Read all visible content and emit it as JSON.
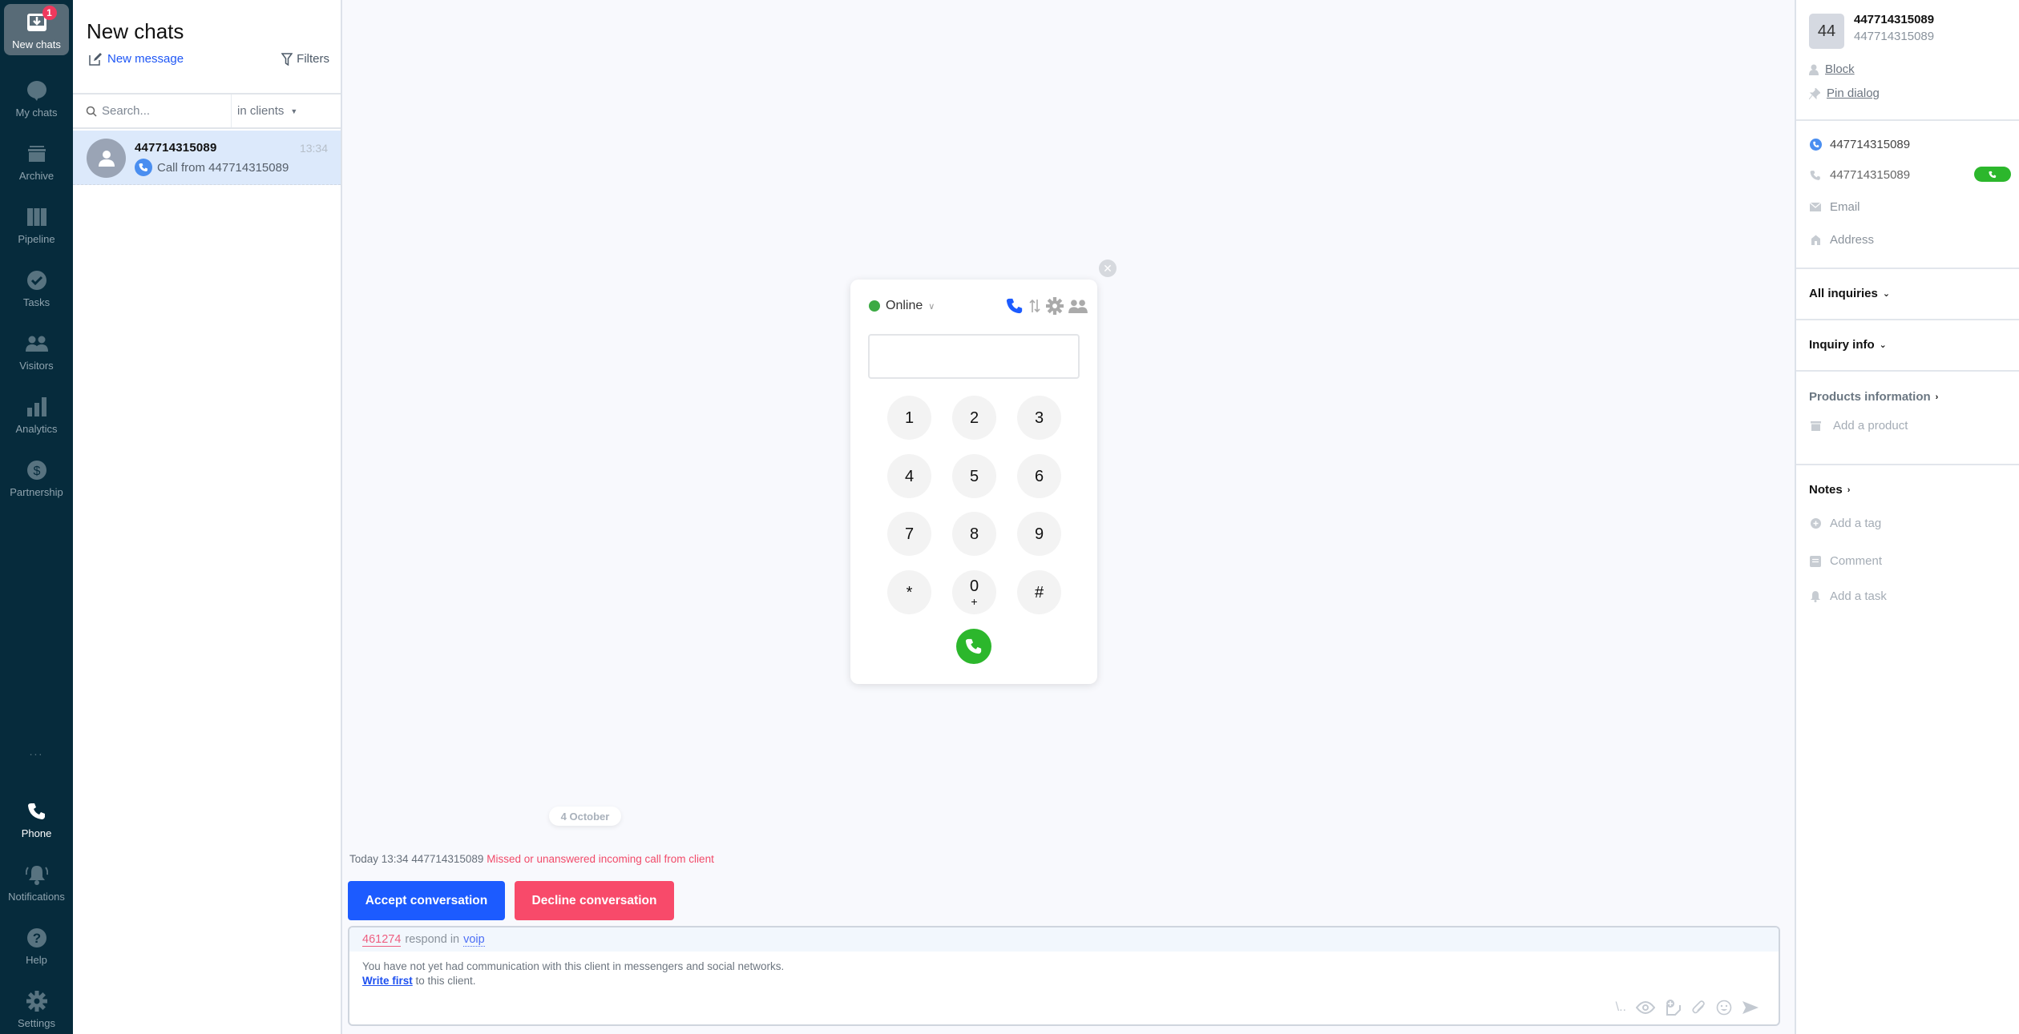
{
  "nav": {
    "items": [
      {
        "label": "New chats",
        "icon": "inbox-icon",
        "badge": "1",
        "active": true
      },
      {
        "label": "My chats",
        "icon": "chat-bubble-icon"
      },
      {
        "label": "Archive",
        "icon": "archive-icon"
      },
      {
        "label": "Pipeline",
        "icon": "pipeline-icon"
      },
      {
        "label": "Tasks",
        "icon": "check-circle-icon"
      },
      {
        "label": "Visitors",
        "icon": "users-icon"
      },
      {
        "label": "Analytics",
        "icon": "bar-chart-icon"
      },
      {
        "label": "Partnership",
        "icon": "dollar-icon"
      }
    ],
    "more": "...",
    "bottom": [
      {
        "label": "Phone",
        "icon": "phone-icon"
      },
      {
        "label": "Notifications",
        "icon": "bell-icon"
      },
      {
        "label": "Help",
        "icon": "help-icon"
      },
      {
        "label": "Settings",
        "icon": "gear-icon"
      }
    ]
  },
  "list": {
    "title": "New chats",
    "new_message": "New message",
    "filters": "Filters",
    "search_placeholder": "Search...",
    "scope": "in clients",
    "chats": [
      {
        "name": "447714315089",
        "time": "13:34",
        "preview": "Call from 447714315089",
        "channel_icon": "phone-icon"
      }
    ]
  },
  "main": {
    "date": "4 October",
    "event": {
      "time": "Today 13:34",
      "from": "447714315089",
      "text": "Missed or unanswered incoming call from client"
    },
    "accept": "Accept conversation",
    "decline": "Decline conversation",
    "composer": {
      "agent": "461274",
      "respond_in": "respond in",
      "channel": "voip",
      "notice": "You have not yet had communication with this client in messengers and social networks.",
      "write_first": "Write first",
      "write_first_suffix": " to this client.",
      "tools": [
        "quick-reply-icon",
        "eye-icon",
        "sticker-add-icon",
        "paperclip-icon",
        "emoji-icon",
        "send-icon"
      ],
      "quick_reply_label": "\\.."
    }
  },
  "dialer": {
    "status": "Online",
    "status_color": "#3caa44",
    "number_value": "",
    "keys": [
      {
        "main": "1"
      },
      {
        "main": "2"
      },
      {
        "main": "3"
      },
      {
        "main": "4"
      },
      {
        "main": "5"
      },
      {
        "main": "6"
      },
      {
        "main": "7"
      },
      {
        "main": "8"
      },
      {
        "main": "9"
      },
      {
        "main": "*"
      },
      {
        "main": "0",
        "sub": "+"
      },
      {
        "main": "#"
      }
    ]
  },
  "right": {
    "avatar": "44",
    "name": "447714315089",
    "subtitle": "447714315089",
    "block": "Block",
    "pin": "Pin dialog",
    "contacts": {
      "voip": "447714315089",
      "phone": "447714315089",
      "email": "Email",
      "address": "Address"
    },
    "all_inquiries": "All inquiries",
    "inquiry_info": "Inquiry info",
    "products": "Products information",
    "add_product": "Add a product",
    "notes": "Notes",
    "add_tag": "Add a tag",
    "comment": "Comment",
    "add_task": "Add a task"
  },
  "colors": {
    "nav_bg": "#062b3c",
    "accent": "#1c5bff",
    "danger": "#f84a6a",
    "call_green": "#2cb72c"
  }
}
